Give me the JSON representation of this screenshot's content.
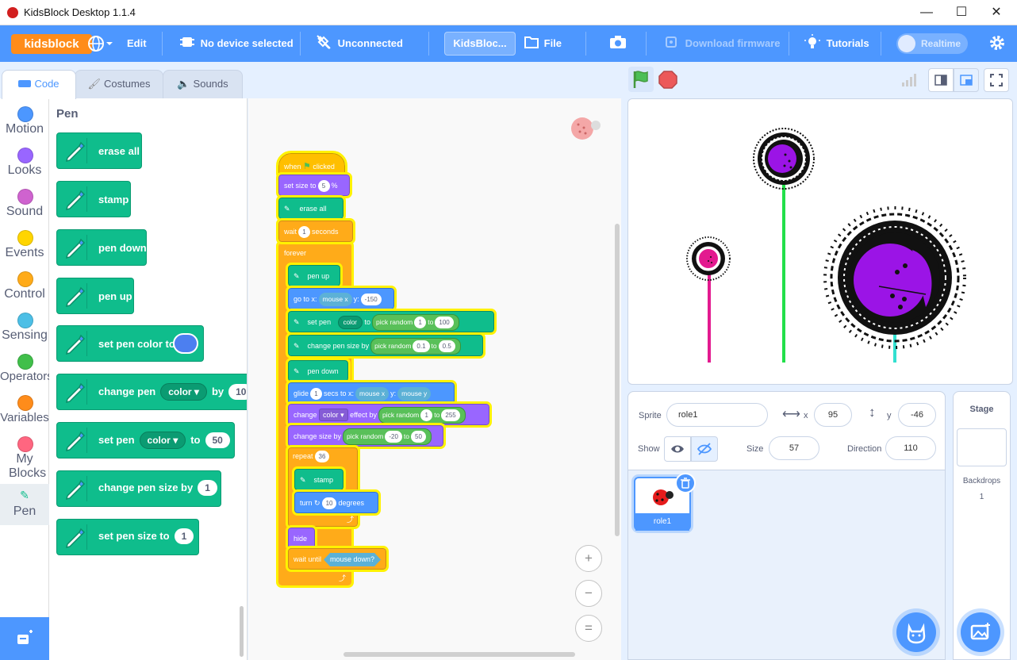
{
  "window": {
    "title": "KidsBlock Desktop 1.1.4",
    "minimize": "—",
    "maximize": "☐",
    "close": "✕"
  },
  "menu": {
    "logo": "kidsblock",
    "edit": "Edit",
    "device": "No device selected",
    "connection": "Unconnected",
    "project_title": "KidsBloc...",
    "file": "File",
    "download_firmware": "Download firmware",
    "tutorials": "Tutorials",
    "realtime": "Realtime"
  },
  "tabs": {
    "code": "Code",
    "costumes": "Costumes",
    "sounds": "Sounds"
  },
  "categories": [
    {
      "label": "Motion",
      "color": "#4c97ff"
    },
    {
      "label": "Looks",
      "color": "#9966ff"
    },
    {
      "label": "Sound",
      "color": "#cf63cf"
    },
    {
      "label": "Events",
      "color": "#ffd500"
    },
    {
      "label": "Control",
      "color": "#ffab19"
    },
    {
      "label": "Sensing",
      "color": "#4cbfe6"
    },
    {
      "label": "Operators",
      "color": "#40bf4a"
    },
    {
      "label": "Variables",
      "color": "#ff8c1a"
    },
    {
      "label": "My Blocks",
      "color": "#ff6680"
    },
    {
      "label": "Pen",
      "color": "#0fbd8c"
    }
  ],
  "palette": {
    "title": "Pen",
    "erase_all": "erase all",
    "stamp": "stamp",
    "pen_down": "pen down",
    "pen_up": "pen up",
    "set_pen_color_to": "set pen color to",
    "change_pen": "change pen",
    "color": "color",
    "by": "by",
    "by_value": "10",
    "set_pen": "set pen",
    "to": "to",
    "set_value": "50",
    "change_pen_size_by": "change pen size by",
    "change_size_value": "1",
    "set_pen_size_to": "set pen size to",
    "set_size_value": "1"
  },
  "script": {
    "when": "when",
    "clicked": "clicked",
    "set_size_to": "set size to",
    "size_val": "5",
    "pct": "%",
    "erase_all": "erase all",
    "wait": "wait",
    "wait_val": "1",
    "seconds": "seconds",
    "forever": "forever",
    "pen_up": "pen up",
    "go_to_x": "go to x:",
    "mouse_x": "mouse x",
    "y": "y:",
    "y_val": "-150",
    "set_pen": "set pen",
    "color": "color",
    "to": "to",
    "pick_random": "pick random",
    "r1a": "1",
    "r1b": "100",
    "change_pen_size_by": "change pen size by",
    "r2a": "0.1",
    "r2b": "0.5",
    "pen_down": "pen down",
    "glide": "glide",
    "glide_val": "1",
    "secs_to_x": "secs to x:",
    "mouse_y": "mouse y",
    "change": "change",
    "effect_by": "effect by",
    "r3a": "1",
    "r3b": "255",
    "change_size_by": "change size by",
    "r4a": "-20",
    "r4b": "50",
    "repeat": "repeat",
    "repeat_val": "36",
    "stamp": "stamp",
    "turn": "turn",
    "turn_val": "10",
    "degrees": "degrees",
    "hide": "hide",
    "wait_until": "wait until",
    "mouse_down": "mouse down?"
  },
  "zoom": {
    "in": "+",
    "out": "−",
    "reset": "="
  },
  "sprite_info": {
    "sprite_label": "Sprite",
    "sprite_name": "role1",
    "x_label": "x",
    "x_val": "95",
    "y_label": "y",
    "y_val": "-46",
    "show_label": "Show",
    "size_label": "Size",
    "size_val": "57",
    "direction_label": "Direction",
    "direction_val": "110"
  },
  "sprites": [
    {
      "name": "role1"
    }
  ],
  "stage_panel": {
    "title": "Stage",
    "backdrops_label": "Backdrops",
    "backdrops_count": "1"
  },
  "colors": {
    "accent": "#4d97ff",
    "pen": "#0fbd8c",
    "highlight": "#fff200"
  }
}
